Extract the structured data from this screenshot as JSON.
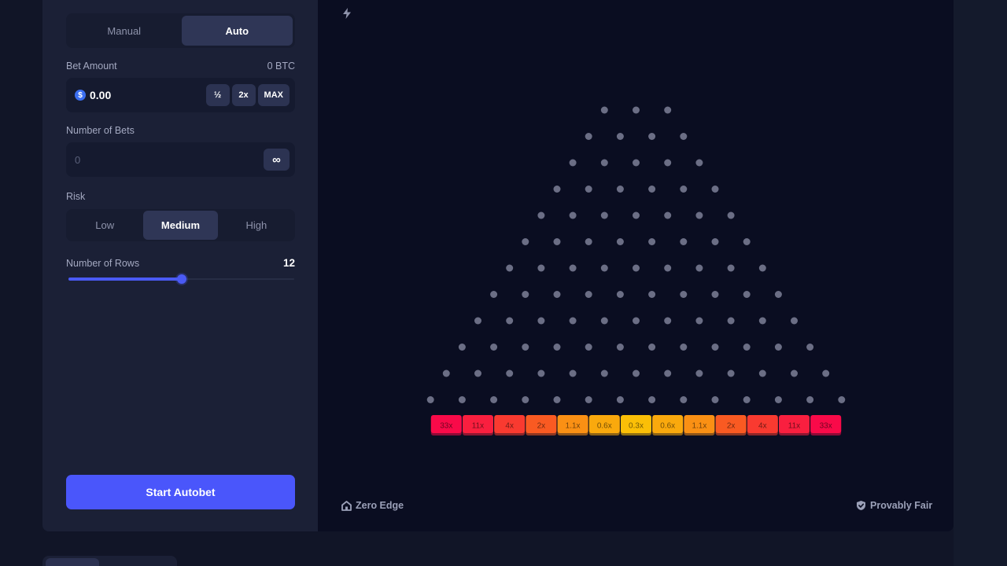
{
  "mode_tabs": [
    "Manual",
    "Auto"
  ],
  "active_mode": "Auto",
  "bet_amount": {
    "label": "Bet Amount",
    "balance": "0 BTC",
    "currency_icon": "dollar-coin-icon",
    "value": "0.00",
    "half_label": "½",
    "double_label": "2x",
    "max_label": "MAX"
  },
  "number_of_bets": {
    "label": "Number of Bets",
    "value": "0",
    "infinite_label": "∞"
  },
  "risk": {
    "label": "Risk",
    "options": [
      "Low",
      "Medium",
      "High"
    ],
    "selected": "Medium"
  },
  "rows": {
    "label": "Number of Rows",
    "value": 12,
    "slider_fraction": 0.5
  },
  "start_button": "Start Autobet",
  "board": {
    "rows": 12,
    "pins_first_row": 3,
    "pin_color": "#6b6e85",
    "multipliers": [
      "33x",
      "11x",
      "4x",
      "2x",
      "1.1x",
      "0.6x",
      "0.3x",
      "0.6x",
      "1.1x",
      "2x",
      "4x",
      "11x",
      "33x"
    ],
    "bucket_colors": [
      "#f90a49",
      "#f91f3f",
      "#f93a30",
      "#f95a22",
      "#fa9014",
      "#faa90d",
      "#fbbf07",
      "#faa90d",
      "#fa9014",
      "#f95a22",
      "#f93a30",
      "#f91f3f",
      "#f90a49"
    ]
  },
  "footer": {
    "zero_edge": "Zero Edge",
    "provably_fair": "Provably Fair"
  },
  "colors": {
    "accent": "#4a56fb",
    "sidebar_bg": "#1b2036",
    "game_bg": "#0a0d21"
  }
}
